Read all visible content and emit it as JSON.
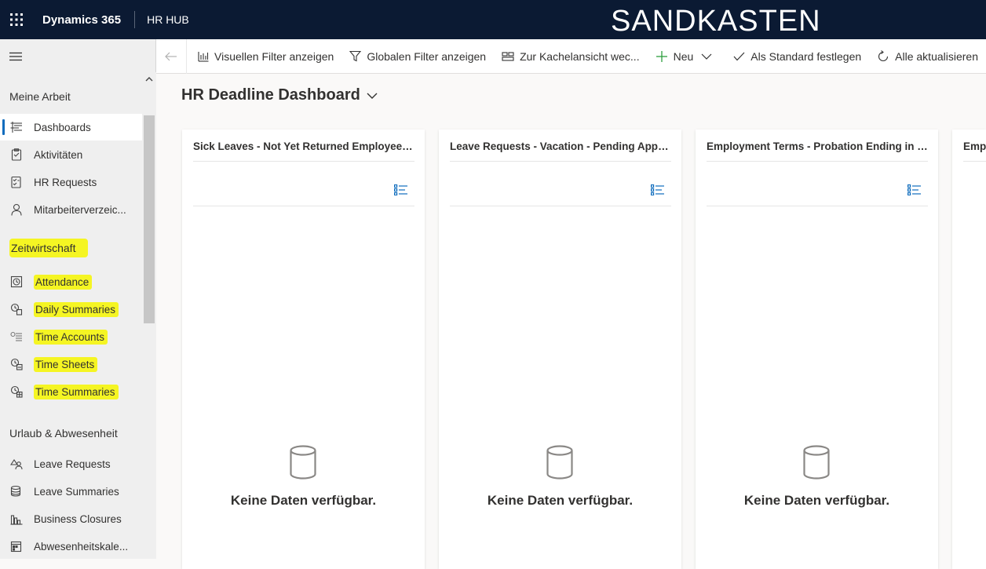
{
  "topbar": {
    "brand": "Dynamics 365",
    "app": "HR HUB",
    "environment": "SANDKASTEN"
  },
  "commands": {
    "visual_filter": "Visuellen Filter anzeigen",
    "global_filter": "Globalen Filter anzeigen",
    "tile_view": "Zur Kachelansicht wec...",
    "new": "Neu",
    "set_default": "Als Standard festlegen",
    "refresh_all": "Alle aktualisieren"
  },
  "sidebar": {
    "groups": [
      {
        "label": "Meine Arbeit"
      },
      {
        "label": "Zeitwirtschaft",
        "highlighted": true
      },
      {
        "label": "Urlaub & Abwesenheit"
      }
    ],
    "items": [
      {
        "label": "Dashboards",
        "icon": "dashboard-icon",
        "active": true
      },
      {
        "label": "Aktivitäten",
        "icon": "clipboard-icon"
      },
      {
        "label": "HR Requests",
        "icon": "checklist-icon"
      },
      {
        "label": "Mitarbeiterverzeic...",
        "icon": "person-icon"
      },
      {
        "label": "Attendance",
        "icon": "clock-icon",
        "highlighted": true
      },
      {
        "label": "Daily Summaries",
        "icon": "clock-doc-icon",
        "highlighted": true
      },
      {
        "label": "Time Accounts",
        "icon": "time-list-icon",
        "highlighted": true
      },
      {
        "label": "Time Sheets",
        "icon": "clock-sheet-icon",
        "highlighted": true
      },
      {
        "label": "Time Summaries",
        "icon": "clock-grid-icon",
        "highlighted": true
      },
      {
        "label": "Leave Requests",
        "icon": "leave-request-icon"
      },
      {
        "label": "Leave Summaries",
        "icon": "coins-icon"
      },
      {
        "label": "Business Closures",
        "icon": "building-chart-icon"
      },
      {
        "label": "Abwesenheitskale...",
        "icon": "calendar-icon"
      }
    ]
  },
  "dashboard": {
    "title": "HR Deadline Dashboard",
    "cards": [
      {
        "title": "Sick Leaves - Not Yet Returned Employee V...",
        "empty": "Keine Daten verfügbar."
      },
      {
        "title": "Leave Requests - Vacation - Pending Appro...",
        "empty": "Keine Daten verfügbar."
      },
      {
        "title": "Employment Terms - Probation Ending in 3...",
        "empty": "Keine Daten verfügbar."
      },
      {
        "title": "Empl",
        "empty": ""
      }
    ]
  }
}
